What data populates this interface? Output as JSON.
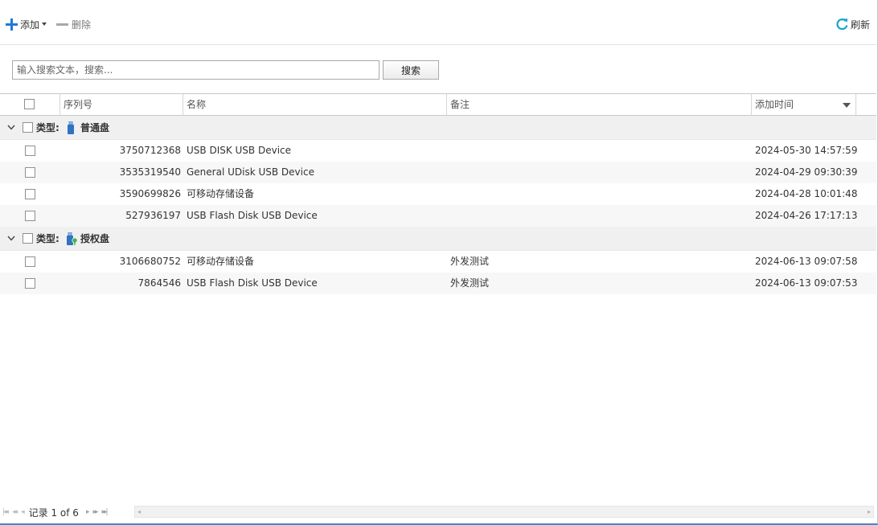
{
  "toolbar": {
    "add_label": "添加",
    "delete_label": "删除",
    "refresh_label": "刷新"
  },
  "search": {
    "placeholder": "输入搜索文本，搜索...",
    "value": "",
    "button_label": "搜索"
  },
  "columns": {
    "serial": "序列号",
    "name": "名称",
    "note": "备注",
    "added_time": "添加时间"
  },
  "groups": [
    {
      "type_label": "类型:",
      "name": "普通盘",
      "icon": "usb-drive-icon",
      "rows": [
        {
          "serial": "3750712368",
          "name": "USB DISK USB Device",
          "note": "",
          "added_time": "2024-05-30 14:57:59"
        },
        {
          "serial": "3535319540",
          "name": "General UDisk USB Device",
          "note": "",
          "added_time": "2024-04-29 09:30:39"
        },
        {
          "serial": "3590699826",
          "name": "可移动存储设备",
          "note": "",
          "added_time": "2024-04-28 10:01:48"
        },
        {
          "serial": "527936197",
          "name": "USB Flash Disk USB Device",
          "note": "",
          "added_time": "2024-04-26 17:17:13"
        }
      ]
    },
    {
      "type_label": "类型:",
      "name": "授权盘",
      "icon": "authorized-drive-icon",
      "rows": [
        {
          "serial": "3106680752",
          "name": "可移动存储设备",
          "note": "外发测试",
          "added_time": "2024-06-13 09:07:58"
        },
        {
          "serial": "7864546",
          "name": "USB Flash Disk USB Device",
          "note": "外发测试",
          "added_time": "2024-06-13 09:07:53"
        }
      ]
    }
  ],
  "pager": {
    "status": "记录 1 of 6"
  },
  "colors": {
    "accent": "#1d7ad6",
    "refresh": "#1aa3c8",
    "group_bg": "#f0f0f0",
    "alt_row_bg": "#f7f7f7"
  }
}
